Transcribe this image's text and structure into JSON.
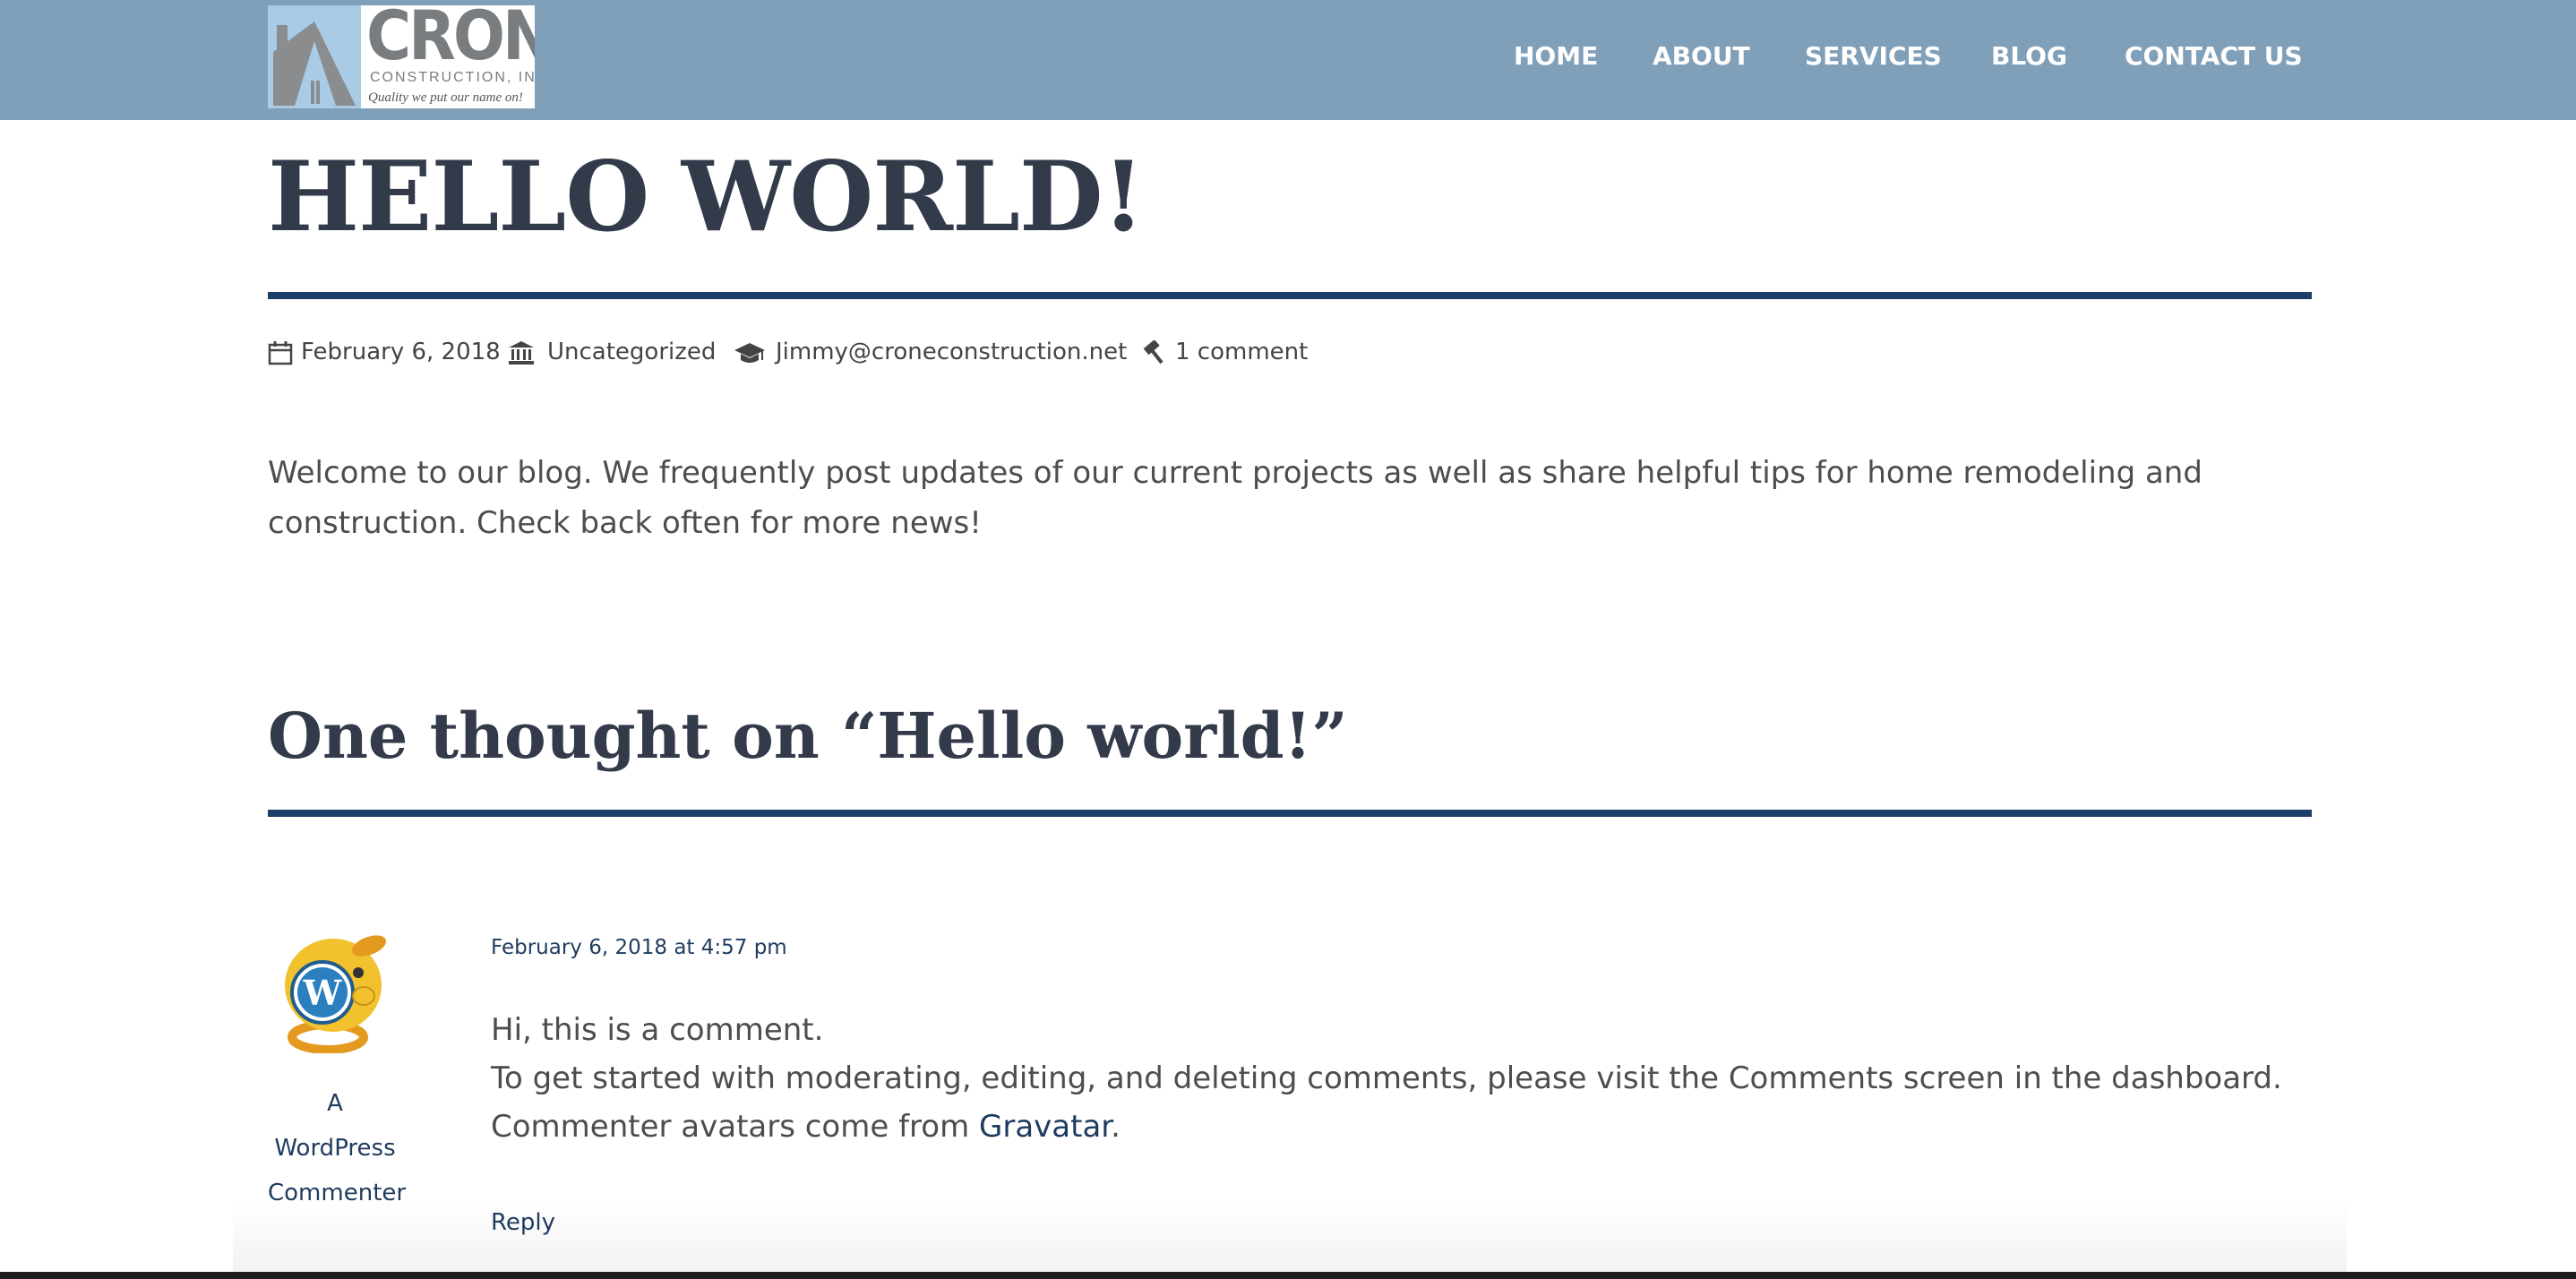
{
  "logo": {
    "name": "CRONE",
    "subtitle": "CONSTRUCTION, INC",
    "tagline": "Quality we put our name on!"
  },
  "nav": {
    "items": [
      {
        "label": "HOME"
      },
      {
        "label": "ABOUT"
      },
      {
        "label": "SERVICES"
      },
      {
        "label": "BLOG"
      },
      {
        "label": "CONTACT US"
      }
    ]
  },
  "post": {
    "title": "HELLO WORLD!",
    "date": "February 6, 2018",
    "category": "Uncategorized",
    "author_email": "Jimmy@croneconstruction.net",
    "comments_link": "1 comment",
    "body": "Welcome to our blog. We frequently post updates of our current projects as well as share helpful tips for home remodeling and construction. Check back often for more news!"
  },
  "comments": {
    "title": "One thought on “Hello world!”",
    "items": [
      {
        "author": "A WordPress Commenter",
        "date": "February 6, 2018 at 4:57 pm",
        "line1": "Hi, this is a comment.",
        "line2": "To get started with moderating, editing, and deleting comments, please visit the Comments screen in the dashboard.",
        "line3_prefix": "Commenter avatars come from ",
        "line3_link": "Gravatar",
        "line3_suffix": ".",
        "reply_label": "Reply"
      }
    ]
  },
  "colors": {
    "header_bg": "#809fb9",
    "accent_rule": "#1b3f68",
    "link": "#1f3b5f",
    "title_text": "#333a4a"
  },
  "icons": {
    "date": "calendar-icon",
    "category": "bank-icon",
    "author": "graduation-cap-icon",
    "comments": "gavel-icon"
  }
}
